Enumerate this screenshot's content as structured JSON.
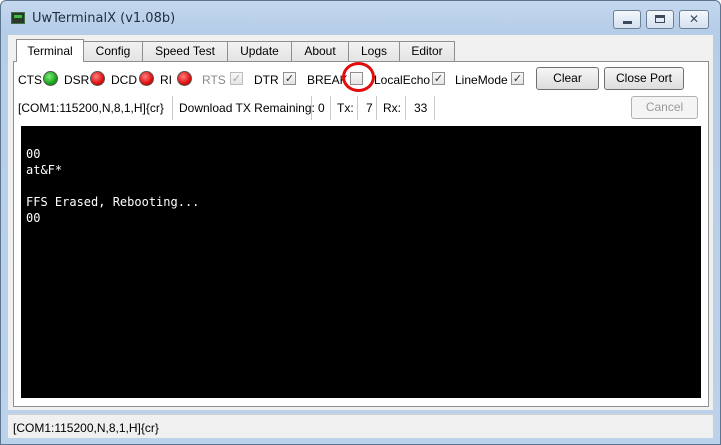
{
  "window": {
    "title": "UwTerminalX (v1.08b)"
  },
  "tabs": [
    "Terminal",
    "Config",
    "Speed Test",
    "Update",
    "About",
    "Logs",
    "Editor"
  ],
  "signals": {
    "cts": {
      "label": "CTS",
      "state": "green"
    },
    "dsr": {
      "label": "DSR",
      "state": "red"
    },
    "dcd": {
      "label": "DCD",
      "state": "red"
    },
    "ri": {
      "label": "RI",
      "state": "red"
    }
  },
  "checkboxes": {
    "rts": {
      "label": "RTS",
      "checked": true,
      "enabled": false
    },
    "dtr": {
      "label": "DTR",
      "checked": true,
      "enabled": true
    },
    "break": {
      "label": "BREAK",
      "checked": false,
      "enabled": true
    },
    "local_echo": {
      "label": "LocalEcho",
      "checked": true,
      "enabled": true
    },
    "line_mode": {
      "label": "LineMode",
      "checked": true,
      "enabled": true
    }
  },
  "buttons": {
    "clear": "Clear",
    "close_port": "Close Port",
    "cancel": "Cancel"
  },
  "info_row": {
    "port_settings": "[COM1:115200,N,8,1,H]{cr}",
    "download_label": "Download TX Remaining:",
    "download_value": "0",
    "tx_label": "Tx:",
    "tx_value": "7",
    "rx_label": "Rx:",
    "rx_value": "33"
  },
  "terminal": {
    "output": "00\nat&F*\n\nFFS Erased, Rebooting...\n00"
  },
  "status_bar": {
    "text": "[COM1:115200,N,8,1,H]{cr}"
  },
  "colors": {
    "highlight_ring": "#e10d0d",
    "led_green": "#1aa31a",
    "led_red": "#e01010",
    "terminal_bg": "#000000"
  }
}
